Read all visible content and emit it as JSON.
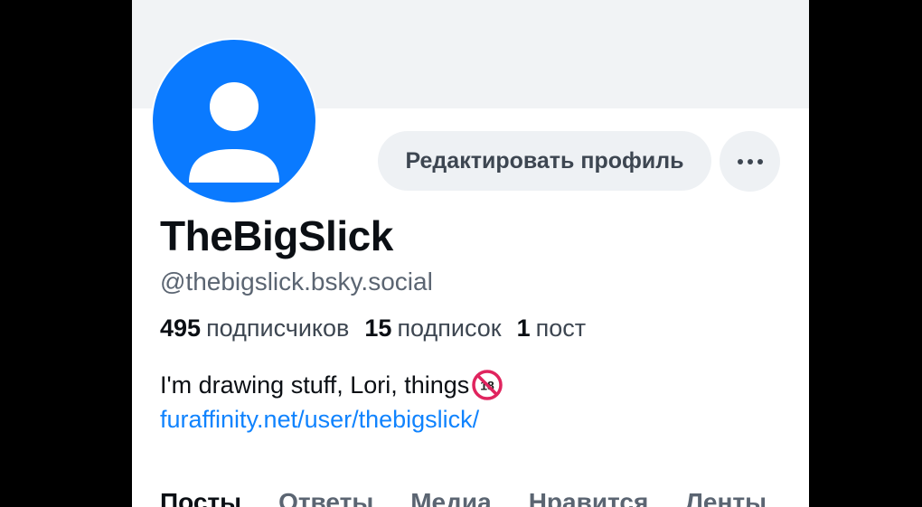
{
  "profile": {
    "display_name": "TheBigSlick",
    "handle": "@thebigslick.bsky.social",
    "bio_text": "I'm drawing stuff, Lori, things",
    "bio_badge_icon": "no-under-18-icon",
    "bio_link": "furaffinity.net/user/thebigslick/",
    "avatar_icon": "default-avatar-icon",
    "avatar_color": "#0a7aff"
  },
  "stats": {
    "followers_count": "495",
    "followers_label": "подписчиков",
    "following_count": "15",
    "following_label": "подписок",
    "posts_count": "1",
    "posts_label": "пост"
  },
  "actions": {
    "edit_profile_label": "Редактировать профиль",
    "more_icon": "more-horizontal-icon"
  },
  "tabs": [
    {
      "label": "Посты",
      "active": true
    },
    {
      "label": "Ответы",
      "active": false
    },
    {
      "label": "Медиа",
      "active": false
    },
    {
      "label": "Нравится",
      "active": false
    },
    {
      "label": "Ленты",
      "active": false
    }
  ],
  "colors": {
    "link": "#1083fe",
    "banner": "#f1f3f5",
    "button_bg": "#eef1f4"
  }
}
